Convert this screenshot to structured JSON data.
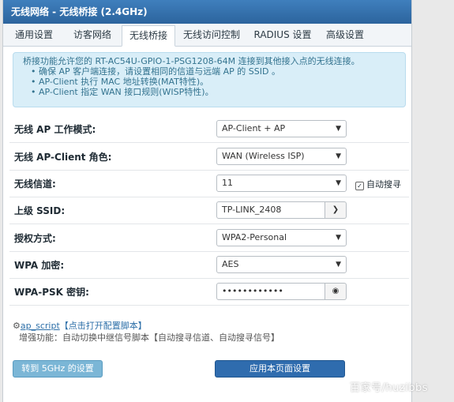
{
  "title": "无线网络 - 无线桥接 (2.4GHz)",
  "tabs": [
    {
      "label": "通用设置"
    },
    {
      "label": "访客网络"
    },
    {
      "label": "无线桥接"
    },
    {
      "label": "无线访问控制"
    },
    {
      "label": "RADIUS 设置"
    },
    {
      "label": "高级设置"
    }
  ],
  "active_tab": "无线桥接",
  "notice": {
    "intro": "桥接功能允许您的 RT-AC54U-GPIO-1-PSG1208-64M 连接到其他接入点的无线连接。",
    "items": [
      "确保 AP 客户端连接，请设置相同的信道与远端 AP 的 SSID 。",
      "AP-Client 执行 MAC 地址转换(MAT特性)。",
      "AP-Client 指定 WAN 接口规则(WISP特性)。"
    ]
  },
  "form": {
    "ap_mode": {
      "label": "无线 AP 工作模式:",
      "value": "AP-Client + AP"
    },
    "apclient_role": {
      "label": "无线 AP-Client 角色:",
      "value": "WAN (Wireless ISP)"
    },
    "channel": {
      "label": "无线信道:",
      "value": "11",
      "auto_search_label": "自动搜寻"
    },
    "ssid": {
      "label": "上级 SSID:",
      "value": "TP-LINK_2408"
    },
    "auth": {
      "label": "授权方式:",
      "value": "WPA2-Personal"
    },
    "wpa_encrypt": {
      "label": "WPA 加密:",
      "value": "AES"
    },
    "psk": {
      "label": "WPA-PSK 密钥:",
      "value": "••••••••••••"
    }
  },
  "script": {
    "link": "ap_script",
    "link_hint": "【点击打开配置脚本】",
    "desc": "增强功能：自动切换中继信号脚本【自动搜寻信道、自动搜寻信号】"
  },
  "buttons": {
    "goto_5g": "转到 5GHz 的设置",
    "apply": "应用本页面设置"
  },
  "watermark": "百家号/huzibbs",
  "colors": {
    "title_bar": "#2c649d",
    "notice_bg": "#d9eef8",
    "apply_button": "#2f6cae",
    "switch_button": "#7bb6d6"
  }
}
